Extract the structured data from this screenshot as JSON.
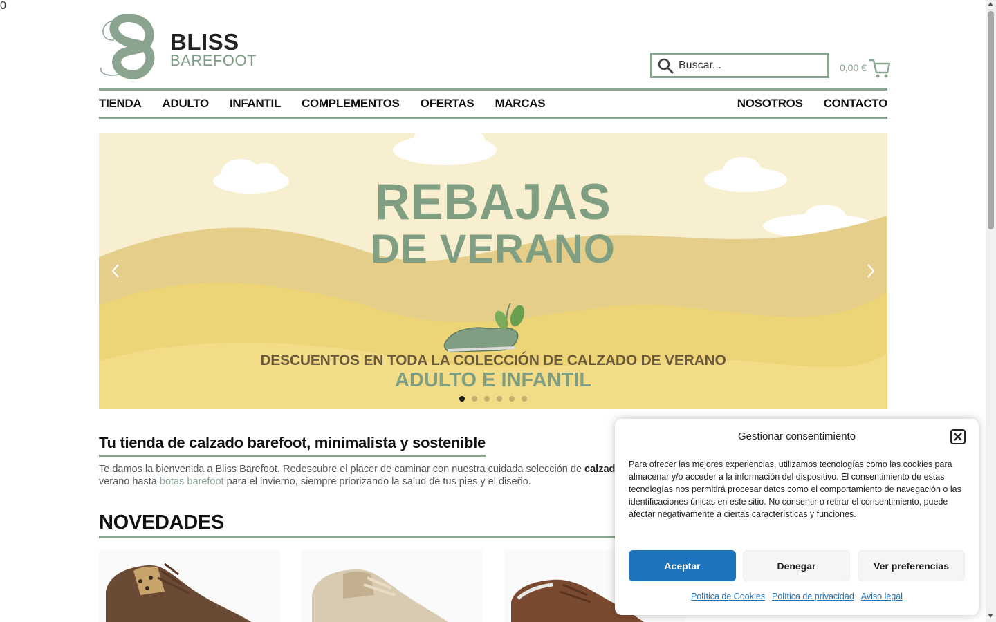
{
  "header": {
    "logo": {
      "line1": "BLISS",
      "line2": "BAREFOOT"
    },
    "search": {
      "placeholder": "Buscar...",
      "icon": "search-icon"
    },
    "cart": {
      "total": "0,00 €",
      "count": "0",
      "icon": "cart-icon"
    }
  },
  "nav": {
    "left": [
      "TIENDA",
      "ADULTO",
      "INFANTIL",
      "COMPLEMENTOS",
      "OFERTAS",
      "MARCAS"
    ],
    "right": [
      "NOSOTROS",
      "CONTACTO"
    ]
  },
  "hero": {
    "title_line1": "REBAJAS",
    "title_line2": "DE VERANO",
    "subtitle_line1": "DESCUENTOS EN TODA LA COLECCIÓN DE CALZADO DE VERANO",
    "subtitle_line2": "ADULTO E INFANTIL",
    "slides_total": 6,
    "active_slide": 1
  },
  "welcome": {
    "title": "Tu tienda de calzado barefoot, minimalista y sostenible",
    "text_part1": "Te damos la bienvenida a Bliss Barefoot. Redescubre el placer de caminar con nuestra cuidada selección de ",
    "text_bold": "calzado resp",
    "text_part2": "verano hasta ",
    "text_link": "botas barefoot",
    "text_part3": " para el invierno, siempre priorizando la salud de tus pies y el diseño."
  },
  "novedades": {
    "title": "NOVEDADES"
  },
  "consent": {
    "title": "Gestionar consentimiento",
    "text": "Para ofrecer las mejores experiencias, utilizamos tecnologías como las cookies para almacenar y/o acceder a la información del dispositivo. El consentimiento de estas tecnologías nos permitirá procesar datos como el comportamiento de navegación o las identificaciones únicas en este sitio. No consentir o retirar el consentimiento, puede afectar negativamente a ciertas características y funciones.",
    "accept": "Aceptar",
    "deny": "Denegar",
    "preferences": "Ver preferencias",
    "links": [
      "Política de Cookies",
      "Política de privacidad",
      "Aviso legal"
    ]
  },
  "colors": {
    "accent": "#8aa48f",
    "primary_button": "#1e73be",
    "badge": "#d9534f"
  }
}
